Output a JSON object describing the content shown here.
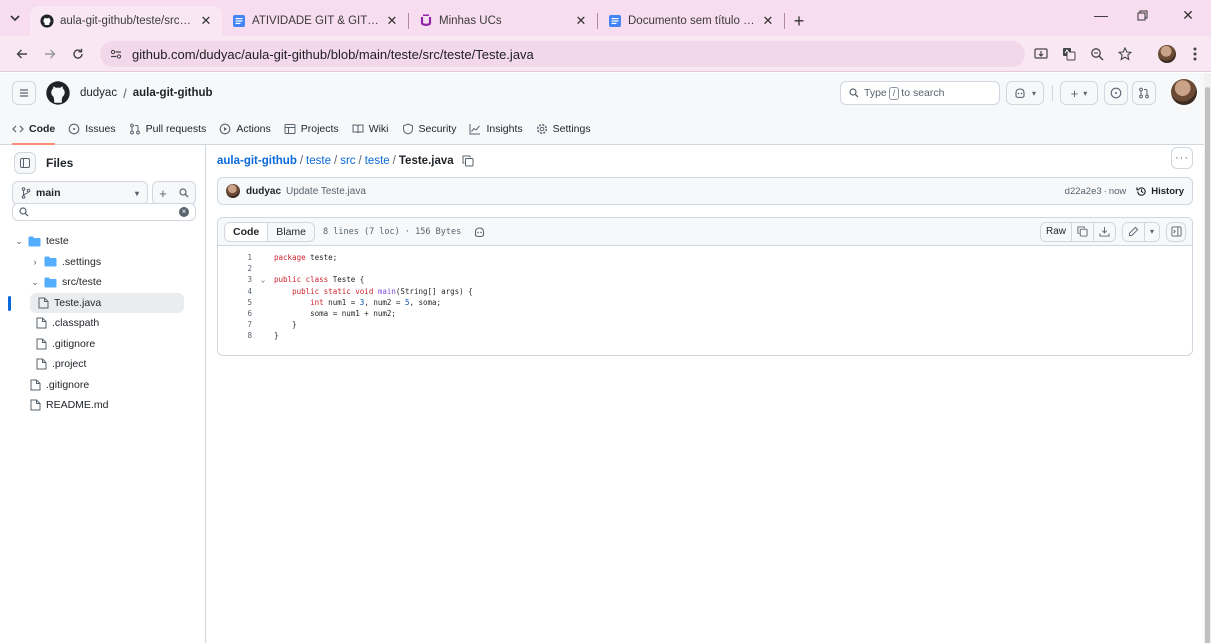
{
  "browser": {
    "tabs": [
      {
        "title": "aula-git-github/teste/src/teste/",
        "icon": "github-icon",
        "active": true
      },
      {
        "title": "ATIVIDADE GIT & GITHUB - Doc",
        "icon": "google-docs-icon",
        "active": false
      },
      {
        "title": "Minhas UCs",
        "icon": "ucs-icon",
        "active": false
      },
      {
        "title": "Documento sem título - Docum",
        "icon": "google-docs-icon",
        "active": false
      }
    ],
    "url": "github.com/dudyac/aula-git-github/blob/main/teste/src/teste/Teste.java"
  },
  "github": {
    "owner": "dudyac",
    "separator": "/",
    "repo": "aula-git-github",
    "search_prefix": "Type",
    "search_key": "/",
    "search_suffix": "to search",
    "nav": [
      {
        "label": "Code",
        "icon": "code-icon",
        "selected": true
      },
      {
        "label": "Issues",
        "icon": "issue-icon",
        "selected": false
      },
      {
        "label": "Pull requests",
        "icon": "pull-request-icon",
        "selected": false
      },
      {
        "label": "Actions",
        "icon": "play-icon",
        "selected": false
      },
      {
        "label": "Projects",
        "icon": "table-icon",
        "selected": false
      },
      {
        "label": "Wiki",
        "icon": "book-icon",
        "selected": false
      },
      {
        "label": "Security",
        "icon": "shield-icon",
        "selected": false
      },
      {
        "label": "Insights",
        "icon": "graph-icon",
        "selected": false
      },
      {
        "label": "Settings",
        "icon": "gear-icon",
        "selected": false
      }
    ]
  },
  "sidebar": {
    "title": "Files",
    "branch": "main",
    "tree": [
      {
        "label": "teste",
        "type": "folder",
        "depth": 0,
        "expanded": true
      },
      {
        "label": ".settings",
        "type": "folder",
        "depth": 1,
        "expanded": false
      },
      {
        "label": "src/teste",
        "type": "folder",
        "depth": 1,
        "expanded": true
      },
      {
        "label": "Teste.java",
        "type": "file",
        "depth": 2,
        "current": true
      },
      {
        "label": ".classpath",
        "type": "file",
        "depth": 1
      },
      {
        "label": ".gitignore",
        "type": "file",
        "depth": 1
      },
      {
        "label": ".project",
        "type": "file",
        "depth": 1
      },
      {
        "label": ".gitignore",
        "type": "file",
        "depth": 0
      },
      {
        "label": "README.md",
        "type": "file",
        "depth": 0
      }
    ]
  },
  "file": {
    "path": [
      "aula-git-github",
      "teste",
      "src",
      "teste"
    ],
    "name": "Teste.java",
    "commit": {
      "author": "dudyac",
      "message": "Update Teste.java",
      "hash": "d22a2e3",
      "time": "now",
      "history_label": "History"
    },
    "view_code_label": "Code",
    "view_blame_label": "Blame",
    "meta": "8 lines (7 loc) · 156 Bytes",
    "raw_label": "Raw",
    "lines": [
      "package teste;",
      "",
      "public class Teste {",
      "    public static void main(String[] args) {",
      "        int num1 = 3, num2 = 5, soma;",
      "        soma = num1 + num2;",
      "    }",
      "}"
    ]
  }
}
